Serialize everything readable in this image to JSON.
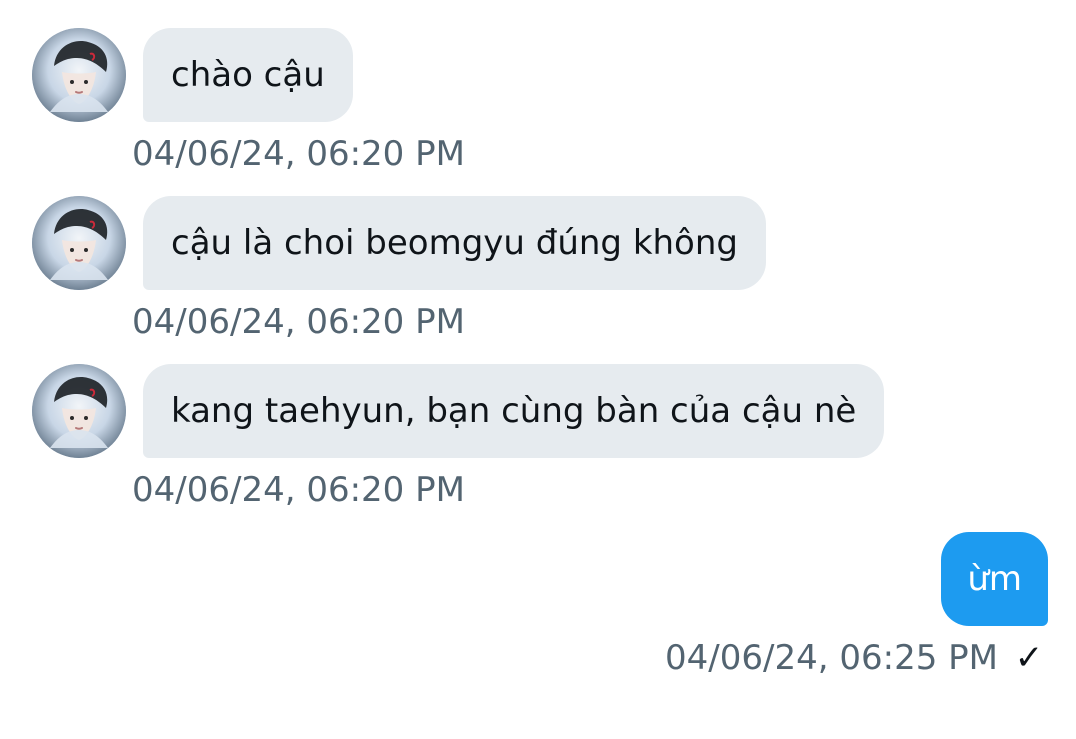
{
  "conversation": {
    "messages": [
      {
        "direction": "incoming",
        "text": "chào cậu",
        "timestamp": "04/06/24, 06:20 PM",
        "avatar_icon": "avatar-icon"
      },
      {
        "direction": "incoming",
        "text": "cậu là choi beomgyu đúng không",
        "timestamp": "04/06/24, 06:20 PM",
        "avatar_icon": "avatar-icon"
      },
      {
        "direction": "incoming",
        "text": "kang taehyun, bạn cùng bàn của cậu nè",
        "timestamp": "04/06/24, 06:20 PM",
        "avatar_icon": "avatar-icon"
      },
      {
        "direction": "outgoing",
        "text": "ừm",
        "timestamp": "04/06/24, 06:25 PM",
        "status_icon": "check-icon",
        "status_symbol": "✓"
      }
    ]
  },
  "colors": {
    "incoming_bubble": "#e6ebef",
    "outgoing_bubble": "#1d9bf0",
    "timestamp_text": "#536471",
    "message_text": "#0f1419"
  }
}
